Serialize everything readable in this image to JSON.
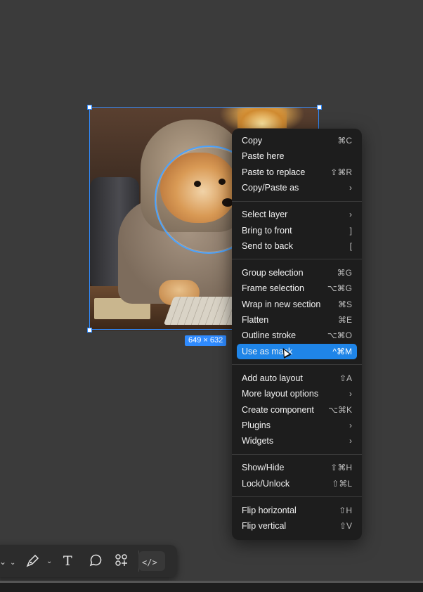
{
  "selection": {
    "dimensions": "649 × 632"
  },
  "context_menu": {
    "groups": [
      [
        {
          "label": "Copy",
          "shortcut": "⌘C"
        },
        {
          "label": "Paste here",
          "shortcut": ""
        },
        {
          "label": "Paste to replace",
          "shortcut": "⇧⌘R"
        },
        {
          "label": "Copy/Paste as",
          "shortcut": "›"
        }
      ],
      [
        {
          "label": "Select layer",
          "shortcut": "›"
        },
        {
          "label": "Bring to front",
          "shortcut": "]"
        },
        {
          "label": "Send to back",
          "shortcut": "["
        }
      ],
      [
        {
          "label": "Group selection",
          "shortcut": "⌘G"
        },
        {
          "label": "Frame selection",
          "shortcut": "⌥⌘G"
        },
        {
          "label": "Wrap in new section",
          "shortcut": "⌘S"
        },
        {
          "label": "Flatten",
          "shortcut": "⌘E"
        },
        {
          "label": "Outline stroke",
          "shortcut": "⌥⌘O"
        },
        {
          "label": "Use as mask",
          "shortcut": "^⌘M",
          "highlighted": true
        }
      ],
      [
        {
          "label": "Add auto layout",
          "shortcut": "⇧A"
        },
        {
          "label": "More layout options",
          "shortcut": "›"
        },
        {
          "label": "Create component",
          "shortcut": "⌥⌘K"
        },
        {
          "label": "Plugins",
          "shortcut": "›"
        },
        {
          "label": "Widgets",
          "shortcut": "›"
        }
      ],
      [
        {
          "label": "Show/Hide",
          "shortcut": "⇧⌘H"
        },
        {
          "label": "Lock/Unlock",
          "shortcut": "⇧⌘L"
        }
      ],
      [
        {
          "label": "Flip horizontal",
          "shortcut": "⇧H"
        },
        {
          "label": "Flip vertical",
          "shortcut": "⇧V"
        }
      ]
    ]
  },
  "toolbar": {
    "tools": [
      {
        "name": "pen-tool",
        "icon": "pen-icon"
      },
      {
        "name": "text-tool",
        "icon": "text-icon"
      },
      {
        "name": "comment-tool",
        "icon": "comment-icon"
      },
      {
        "name": "actions-tool",
        "icon": "actions-icon"
      },
      {
        "name": "dev-mode",
        "icon": "code-icon"
      }
    ],
    "text_glyph": "T",
    "code_glyph": "</>"
  },
  "colors": {
    "accent": "#1f85e8",
    "menu_bg": "#1d1d1d",
    "canvas": "#3b3b3b"
  }
}
